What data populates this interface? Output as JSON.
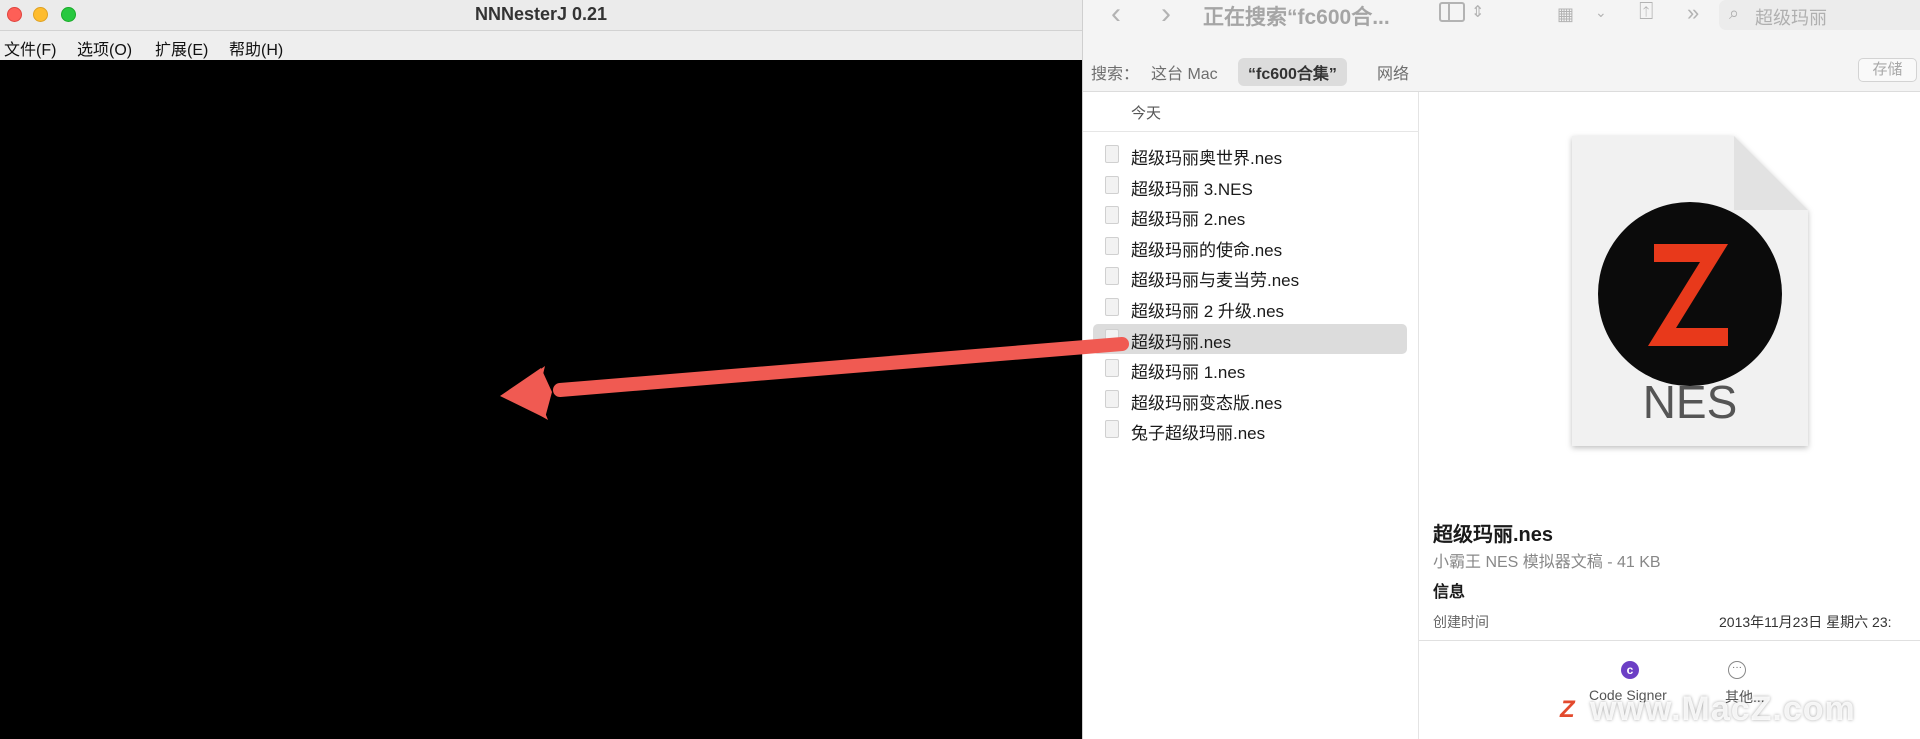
{
  "emulator": {
    "title": "NNNesterJ 0.21",
    "menu": [
      "文件(F)",
      "选项(O)",
      "扩展(E)",
      "帮助(H)"
    ]
  },
  "finder": {
    "title": "正在搜索“fc600合...",
    "search_value": "超级玛丽",
    "scope": {
      "label": "搜索：",
      "this_mac": "这台 Mac",
      "folder": "“fc600合集”",
      "network": "网络",
      "save": "存储"
    },
    "section_header": "今天",
    "files": [
      "超级玛丽奥世界.nes",
      "超级玛丽 3.NES",
      "超级玛丽 2.nes",
      "超级玛丽的使命.nes",
      "超级玛丽与麦当劳.nes",
      "超级玛丽 2 升级.nes",
      "超级玛丽.nes",
      "超级玛丽 1.nes",
      "超级玛丽变态版.nes",
      "兔子超级玛丽.nes"
    ],
    "selected_index": 6,
    "preview": {
      "icon_letter": "Z",
      "icon_ext": "NES",
      "file_name": "超级玛丽.nes",
      "file_kind": "小霸王 NES 模拟器文稿 - 41 KB",
      "info_heading": "信息",
      "created_label": "创建时间",
      "created_value": "2013年11月23日 星期六 23:",
      "actions": {
        "code_signer": "Code Signer",
        "more": "其他..."
      }
    }
  },
  "watermark": {
    "logo": "Z",
    "text": "www.MacZ.com"
  },
  "colors": {
    "arrow": "#f05a52",
    "brand_red": "#e8391b",
    "selection": "#dcdcdc"
  }
}
